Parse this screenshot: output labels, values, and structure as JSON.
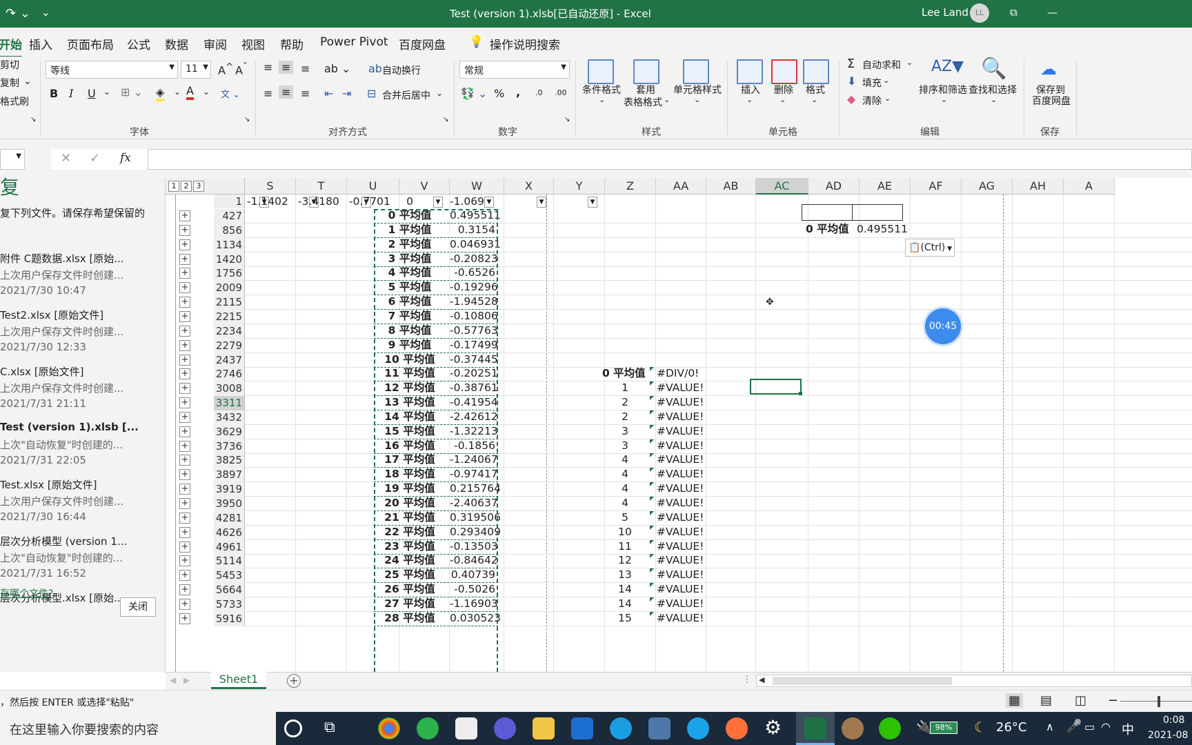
{
  "titlebar": {
    "title": "Test (version 1).xlsb[已自动还原]  -  Excel",
    "user": "Lee Land",
    "avatar": "LL",
    "minimize": "—",
    "restore": "⧉"
  },
  "menu": [
    "开始",
    "插入",
    "页面布局",
    "公式",
    "数据",
    "审阅",
    "视图",
    "帮助",
    "Power Pivot",
    "百度网盘",
    "操作说明搜索"
  ],
  "ribbon": {
    "clipboard": {
      "cut": "剪切",
      "copy": "复制",
      "painter": "格式刷"
    },
    "font": {
      "name": "等线",
      "size": "11",
      "bold": "B",
      "italic": "I",
      "underline": "U",
      "group": "字体"
    },
    "align": {
      "wrap": "自动换行",
      "merge": "合并后居中",
      "group": "对齐方式"
    },
    "number": {
      "format": "常规",
      "percent": "%",
      "comma": ",",
      "group": "数字"
    },
    "styles": {
      "cond": "条件格式",
      "table1": "套用",
      "table2": "表格格式",
      "cell": "单元格样式",
      "group": "样式"
    },
    "cells": {
      "insert": "插入",
      "delete": "删除",
      "format": "格式",
      "group": "单元格"
    },
    "editing": {
      "autosum": "自动求和",
      "fill": "填充",
      "clear": "清除",
      "sort": "排序和筛选",
      "find": "查找和选择",
      "group": "编辑"
    },
    "save": {
      "line1": "保存到",
      "line2": "百度网盘",
      "group": "保存"
    }
  },
  "formula_bar": {
    "cancel": "✕",
    "enter": "✓",
    "fx": "fx"
  },
  "recovery": {
    "title": "复",
    "desc": "复下列文件。请保存希望保留的",
    "files": [
      {
        "name": "附件 C题数据.xlsx  [原始...",
        "note": "上次用户保存文件时创建...",
        "time": "2021/7/30 10:47",
        "bold": false
      },
      {
        "name": "Test2.xlsx  [原始文件]",
        "note": "上次用户保存文件时创建...",
        "time": "2021/7/30 12:33",
        "bold": false
      },
      {
        "name": "C.xlsx  [原始文件]",
        "note": "上次用户保存文件时创建...",
        "time": "2021/7/31 21:11",
        "bold": false
      },
      {
        "name": "Test (version 1).xlsb  [...",
        "note": "上次\"自动恢复\"时创建的...",
        "time": "2021/7/31 22:05",
        "bold": true
      },
      {
        "name": "Test.xlsx  [原始文件]",
        "note": "上次用户保存文件时创建...",
        "time": "2021/7/30 16:44",
        "bold": false
      },
      {
        "name": "层次分析模型 (version 1...",
        "note": "上次\"自动恢复\"时创建的...",
        "time": "2021/7/31 16:52",
        "bold": false
      },
      {
        "name": "层次分析模型.xlsx  [原始...",
        "note": "",
        "time": "",
        "bold": false
      }
    ],
    "link": "存哪个文件?",
    "close": "关闭"
  },
  "grid": {
    "levels": [
      "1",
      "2",
      "3"
    ],
    "columns": [
      "S",
      "T",
      "U",
      "V",
      "W",
      "X",
      "Y",
      "Z",
      "AA",
      "AB",
      "AC",
      "AD",
      "AE",
      "AF",
      "AG",
      "AH",
      "A"
    ],
    "filter_row": {
      "row": "1",
      "S": "-1.1402",
      "T": "-3.4180",
      "U": "-0.7701",
      "V": "0",
      "W": "-1.069"
    },
    "row_numbers": [
      "427",
      "856",
      "1134",
      "1420",
      "1756",
      "2009",
      "2115",
      "2215",
      "2234",
      "2279",
      "2437",
      "2746",
      "3008",
      "3311",
      "3432",
      "3629",
      "3736",
      "3825",
      "3897",
      "3919",
      "3950",
      "4281",
      "4626",
      "4961",
      "5114",
      "5453",
      "5664",
      "5733",
      "5916"
    ],
    "v_labels": [
      "0 平均值",
      "1 平均值",
      "2 平均值",
      "3 平均值",
      "4 平均值",
      "5 平均值",
      "6 平均值",
      "7 平均值",
      "8 平均值",
      "9 平均值",
      "10 平均值",
      "11 平均值",
      "12 平均值",
      "13 平均值",
      "14 平均值",
      "15 平均值",
      "16 平均值",
      "17 平均值",
      "18 平均值",
      "19 平均值",
      "20 平均值",
      "21 平均值",
      "22 平均值",
      "23 平均值",
      "24 平均值",
      "25 平均值",
      "26 平均值",
      "27 平均值",
      "28 平均值"
    ],
    "w_values": [
      "0.495511",
      "0.3154",
      "0.046931",
      "-0.20823",
      "-0.6526",
      "-0.19296",
      "-1.94528",
      "-0.10806",
      "-0.57763",
      "-0.17499",
      "-0.37445",
      "-0.20251",
      "-0.38761",
      "-0.41954",
      "-2.42612",
      "-1.32213",
      "-0.1856",
      "-1.24067",
      "-0.97417",
      "0.215764",
      "-2.40637",
      "0.319506",
      "0.293409",
      "-0.13503",
      "-0.84642",
      "0.40739",
      "-0.5026",
      "-1.16903",
      "0.030523"
    ],
    "z_header": "0 平均值",
    "aa_header": "#DIV/0!",
    "z_values": [
      "1",
      "2",
      "2",
      "3",
      "3",
      "4",
      "4",
      "4",
      "4",
      "5",
      "10",
      "11",
      "12",
      "13",
      "14",
      "14",
      "15"
    ],
    "aa_values": [
      "#VALUE!",
      "#VALUE!",
      "#VALUE!",
      "#VALUE!",
      "#VALUE!",
      "#VALUE!",
      "#VALUE!",
      "#VALUE!",
      "#VALUE!",
      "#VALUE!",
      "#VALUE!",
      "#VALUE!",
      "#VALUE!",
      "#VALUE!",
      "#VALUE!",
      "#VALUE!",
      "#VALUE!"
    ],
    "ad_label": "0 平均值",
    "ae_value": "0.495511",
    "paste_ctrl": "(Ctrl)",
    "timer": "00:45"
  },
  "sheet": {
    "tab": "Sheet1",
    "add": "+"
  },
  "status": {
    "message": "，然后按 ENTER 或选择\"粘贴\""
  },
  "taskbar": {
    "search": "在这里输入你要搜索的内容",
    "battery": "98%",
    "temp": "26°C",
    "ime": "中",
    "time": "0:08",
    "date": "2021-08"
  }
}
